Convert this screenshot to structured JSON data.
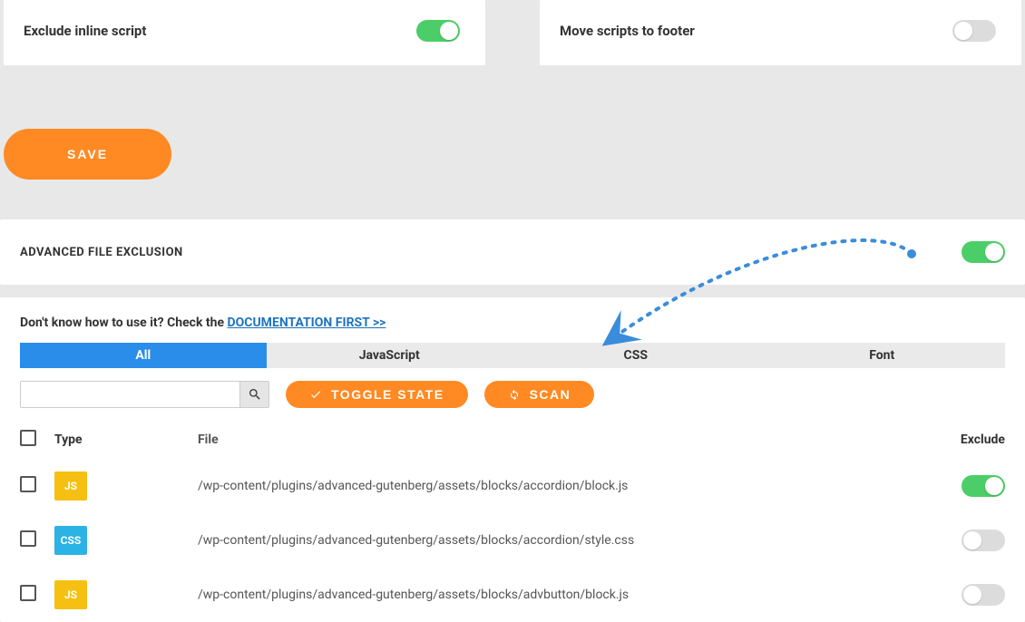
{
  "toggles": {
    "exclude_inline_script": {
      "label": "Exclude inline script",
      "on": true
    },
    "move_scripts_footer": {
      "label": "Move scripts to footer",
      "on": false
    },
    "advanced_exclusion": {
      "on": true
    }
  },
  "save_label": "SAVE",
  "advanced_title": "ADVANCED FILE EXCLUSION",
  "help": {
    "prefix": "Don't know how to use it? Check the ",
    "link_text": "DOCUMENTATION FIRST >>"
  },
  "tabs": {
    "all": "All",
    "js": "JavaScript",
    "css": "CSS",
    "font": "Font",
    "active": "all"
  },
  "search": {
    "value": ""
  },
  "buttons": {
    "toggle_state": "TOGGLE STATE",
    "scan": "SCAN"
  },
  "columns": {
    "type": "Type",
    "file": "File",
    "exclude": "Exclude"
  },
  "rows": [
    {
      "type": "JS",
      "file": "/wp-content/plugins/advanced-gutenberg/assets/blocks/accordion/block.js",
      "excluded": true
    },
    {
      "type": "CSS",
      "file": "/wp-content/plugins/advanced-gutenberg/assets/blocks/accordion/style.css",
      "excluded": false
    },
    {
      "type": "JS",
      "file": "/wp-content/plugins/advanced-gutenberg/assets/blocks/advbutton/block.js",
      "excluded": false
    }
  ]
}
